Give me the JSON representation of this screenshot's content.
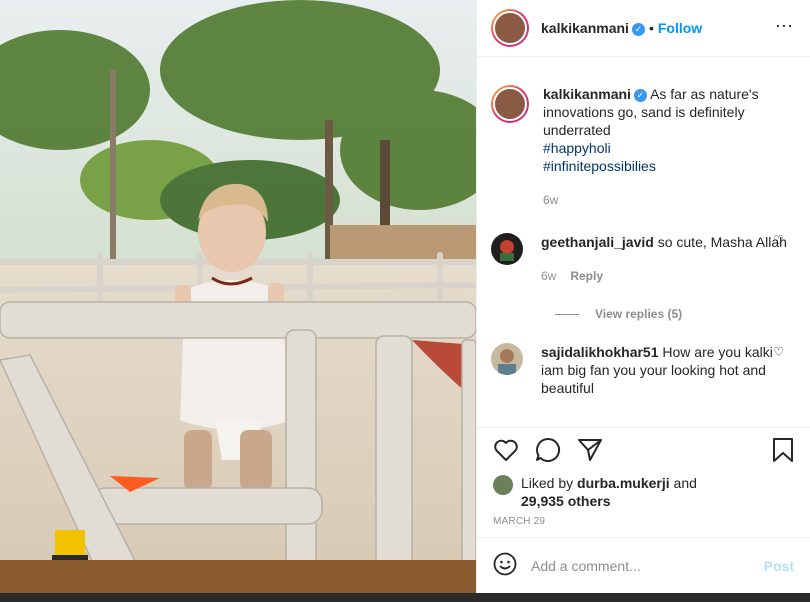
{
  "post": {
    "author": "kalkikanmani",
    "follow_label": "Follow",
    "separator": "•",
    "more_icon": "more-options-icon"
  },
  "caption": {
    "author": "kalkikanmani",
    "text": "As far as nature's innovations go, sand is definitely underrated",
    "hashtags": [
      "#happyholi",
      "#infinitepossibilies"
    ],
    "age": "6w"
  },
  "comments": [
    {
      "author": "geethanjali_javid",
      "text": "so cute, Masha Allah",
      "age": "6w",
      "reply_label": "Reply",
      "view_replies": "View replies (5)"
    },
    {
      "author": "sajidalikhokhar51",
      "text": "How are you kalki iam big fan you your looking hot and beautiful"
    }
  ],
  "engagement": {
    "liked_by_prefix": "Liked by",
    "liked_by_user": "durba.mukerji",
    "and": "and",
    "others": "29,935 others",
    "date": "MARCH 29"
  },
  "composer": {
    "placeholder": "Add a comment...",
    "post_label": "Post"
  },
  "colors": {
    "accent": "#0095f6",
    "post_disabled": "#b2dffc",
    "hashtag": "#00376b",
    "muted": "#8e8e8e"
  }
}
